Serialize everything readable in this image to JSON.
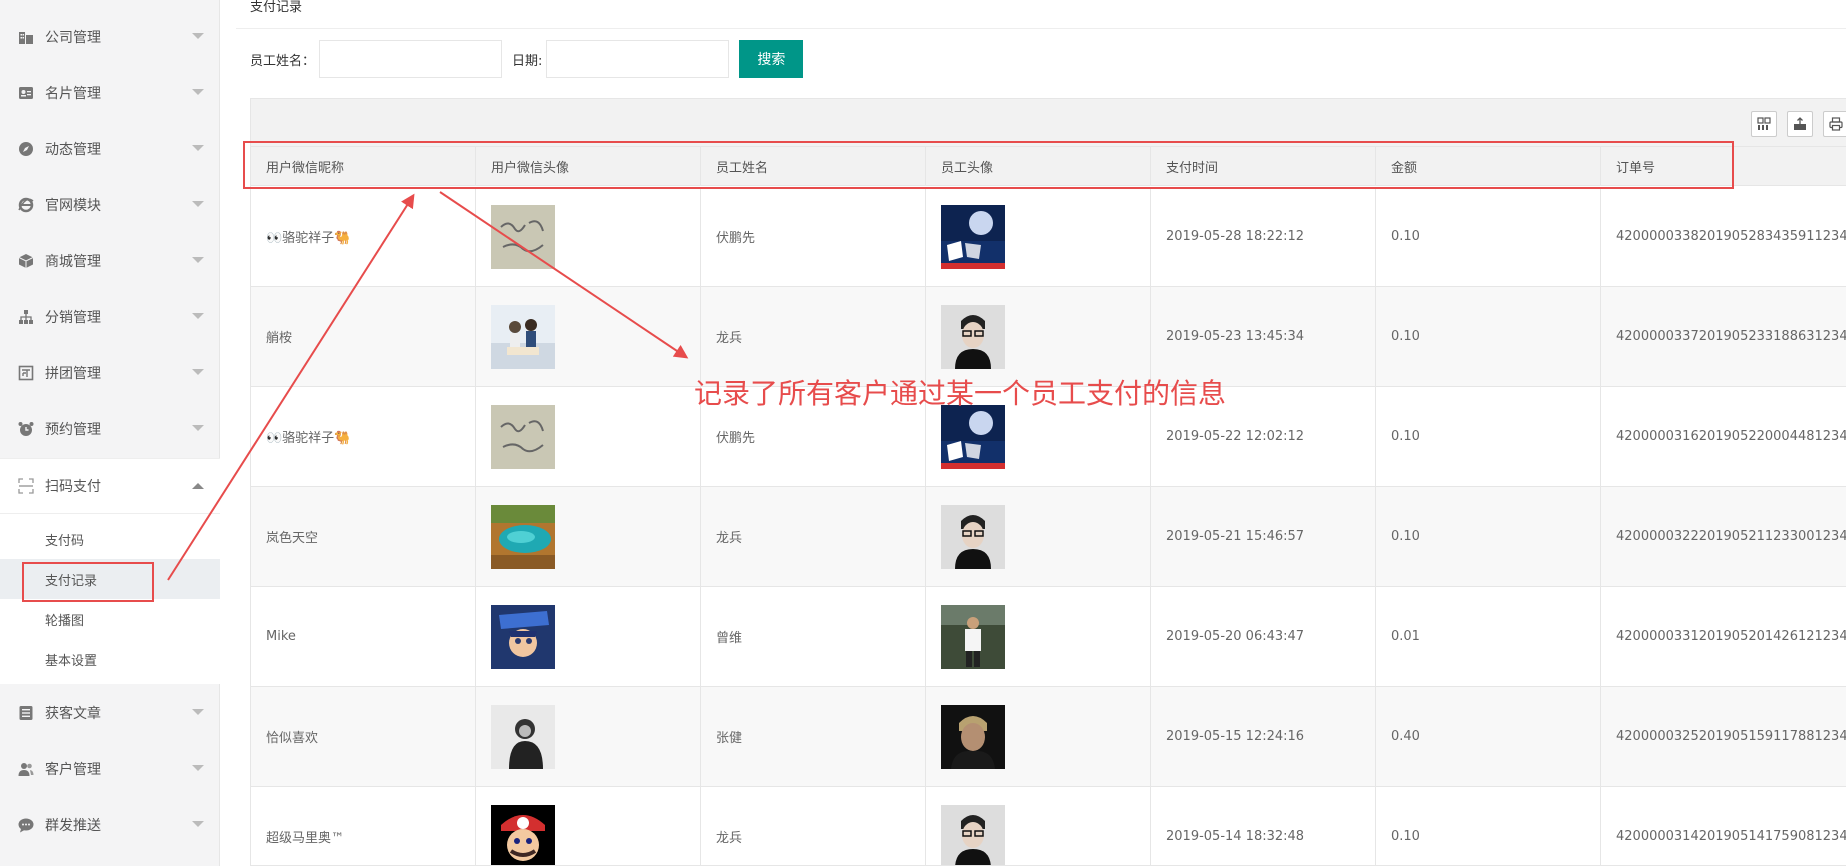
{
  "sidebar": {
    "items": [
      {
        "label": "公司管理",
        "icon": "building-icon"
      },
      {
        "label": "名片管理",
        "icon": "card-icon"
      },
      {
        "label": "动态管理",
        "icon": "compass-icon"
      },
      {
        "label": "官网模块",
        "icon": "ie-icon"
      },
      {
        "label": "商城管理",
        "icon": "cube-icon"
      },
      {
        "label": "分销管理",
        "icon": "sitemap-icon"
      },
      {
        "label": "拼团管理",
        "icon": "group-icon"
      },
      {
        "label": "预约管理",
        "icon": "alarm-icon"
      },
      {
        "label": "扫码支付",
        "icon": "scan-icon"
      },
      {
        "label": "获客文章",
        "icon": "article-icon"
      },
      {
        "label": "客户管理",
        "icon": "users-icon"
      },
      {
        "label": "群发推送",
        "icon": "chat-icon"
      }
    ],
    "submenu": [
      "支付码",
      "支付记录",
      "轮播图",
      "基本设置"
    ]
  },
  "page": {
    "title": "支付记录",
    "filter": {
      "name_label": "员工姓名：",
      "date_label": "日期:",
      "search_label": "搜索"
    }
  },
  "table": {
    "columns": [
      "用户微信昵称",
      "用户微信头像",
      "员工姓名",
      "员工头像",
      "支付时间",
      "金额",
      "订单号"
    ],
    "rows": [
      {
        "nickname": "👀骆驼祥子🐫",
        "staff": "伏鹏先",
        "time": "2019-05-28 18:22:12",
        "amount": "0.10",
        "order": "4200000338201905283435911234",
        "user_avatar": "handwriting",
        "staff_avatar": "moon"
      },
      {
        "nickname": "艄桉",
        "staff": "龙兵",
        "time": "2019-05-23 13:45:34",
        "amount": "0.10",
        "order": "4200000337201905233188631234",
        "user_avatar": "couple",
        "staff_avatar": "glasses"
      },
      {
        "nickname": "👀骆驼祥子🐫",
        "staff": "伏鹏先",
        "time": "2019-05-22 12:02:12",
        "amount": "0.10",
        "order": "4200000316201905220004481234",
        "user_avatar": "handwriting",
        "staff_avatar": "moon"
      },
      {
        "nickname": "岚色天空",
        "staff": "龙兵",
        "time": "2019-05-21 15:46:57",
        "amount": "0.10",
        "order": "4200000322201905211233001234",
        "user_avatar": "lake",
        "staff_avatar": "glasses"
      },
      {
        "nickname": "Mike",
        "staff": "曾维",
        "time": "2019-05-20 06:43:47",
        "amount": "0.01",
        "order": "4200000331201905201426121234",
        "user_avatar": "game",
        "staff_avatar": "outdoor"
      },
      {
        "nickname": "恰似喜欢",
        "staff": "张健",
        "time": "2019-05-15 12:24:16",
        "amount": "0.40",
        "order": "4200000325201905159117881234",
        "user_avatar": "bw",
        "staff_avatar": "dark"
      },
      {
        "nickname": "超级马里奥™",
        "staff": "龙兵",
        "time": "2019-05-14 18:32:48",
        "amount": "0.10",
        "order": "4200000314201905141759081234",
        "user_avatar": "mario",
        "staff_avatar": "glasses"
      }
    ]
  },
  "annotation": {
    "text": "记录了所有客户通过某一个员工支付的信息",
    "color": "#e74c4c"
  },
  "colors": {
    "accent": "#009688",
    "annotation": "#e74c4c"
  }
}
